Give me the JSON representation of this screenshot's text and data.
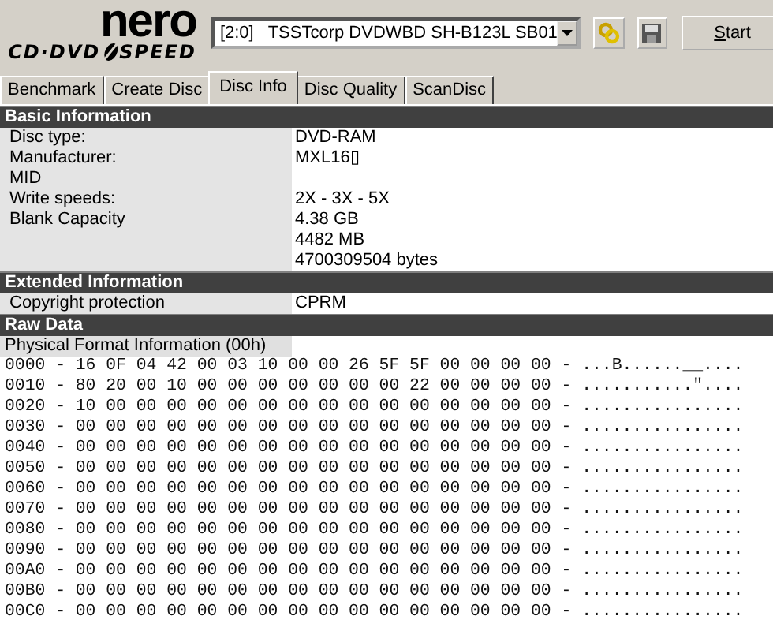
{
  "toolbar": {
    "logo_name": "nero",
    "logo_left": "CD·DVD",
    "logo_right": "SPEED",
    "drive": "[2:0]   TSSTcorp DVDWBD SH-B123L SB01",
    "start_button": "Start"
  },
  "tabs": [
    {
      "label": "Benchmark",
      "selected": false
    },
    {
      "label": "Create Disc",
      "selected": false
    },
    {
      "label": "Disc Info",
      "selected": true
    },
    {
      "label": "Disc Quality",
      "selected": false
    },
    {
      "label": "ScanDisc",
      "selected": false
    }
  ],
  "sections": [
    {
      "title": "Basic Information",
      "rows": [
        {
          "label": "Disc type:",
          "values": [
            "DVD-RAM"
          ]
        },
        {
          "label": "Manufacturer:",
          "values": [
            "MXL16▯"
          ]
        },
        {
          "label": "MID"
        },
        {
          "label": "Write speeds:",
          "values": [
            "2X - 3X - 5X"
          ]
        },
        {
          "label": "Blank Capacity",
          "values": [
            "4.38 GB",
            "4482 MB",
            "4700309504 bytes"
          ]
        }
      ]
    },
    {
      "title": "Extended Information",
      "rows": [
        {
          "label": "Copyright protection",
          "values": [
            "CPRM"
          ]
        }
      ]
    }
  ],
  "raw_data": {
    "title": "Raw Data",
    "subheading": "Physical Format Information (00h)",
    "lines": [
      "0000 - 16 0F 04 42 00 03 10 00 00 26 5F 5F 00 00 00 00 - ...B......__....",
      "0010 - 80 20 00 10 00 00 00 00 00 00 00 22 00 00 00 00 - ...........\"....",
      "0020 - 10 00 00 00 00 00 00 00 00 00 00 00 00 00 00 00 - ................",
      "0030 - 00 00 00 00 00 00 00 00 00 00 00 00 00 00 00 00 - ................",
      "0040 - 00 00 00 00 00 00 00 00 00 00 00 00 00 00 00 00 - ................",
      "0050 - 00 00 00 00 00 00 00 00 00 00 00 00 00 00 00 00 - ................",
      "0060 - 00 00 00 00 00 00 00 00 00 00 00 00 00 00 00 00 - ................",
      "0070 - 00 00 00 00 00 00 00 00 00 00 00 00 00 00 00 00 - ................",
      "0080 - 00 00 00 00 00 00 00 00 00 00 00 00 00 00 00 00 - ................",
      "0090 - 00 00 00 00 00 00 00 00 00 00 00 00 00 00 00 00 - ................",
      "00A0 - 00 00 00 00 00 00 00 00 00 00 00 00 00 00 00 00 - ................",
      "00B0 - 00 00 00 00 00 00 00 00 00 00 00 00 00 00 00 00 - ................",
      "00C0 - 00 00 00 00 00 00 00 00 00 00 00 00 00 00 00 00 - ................"
    ]
  }
}
